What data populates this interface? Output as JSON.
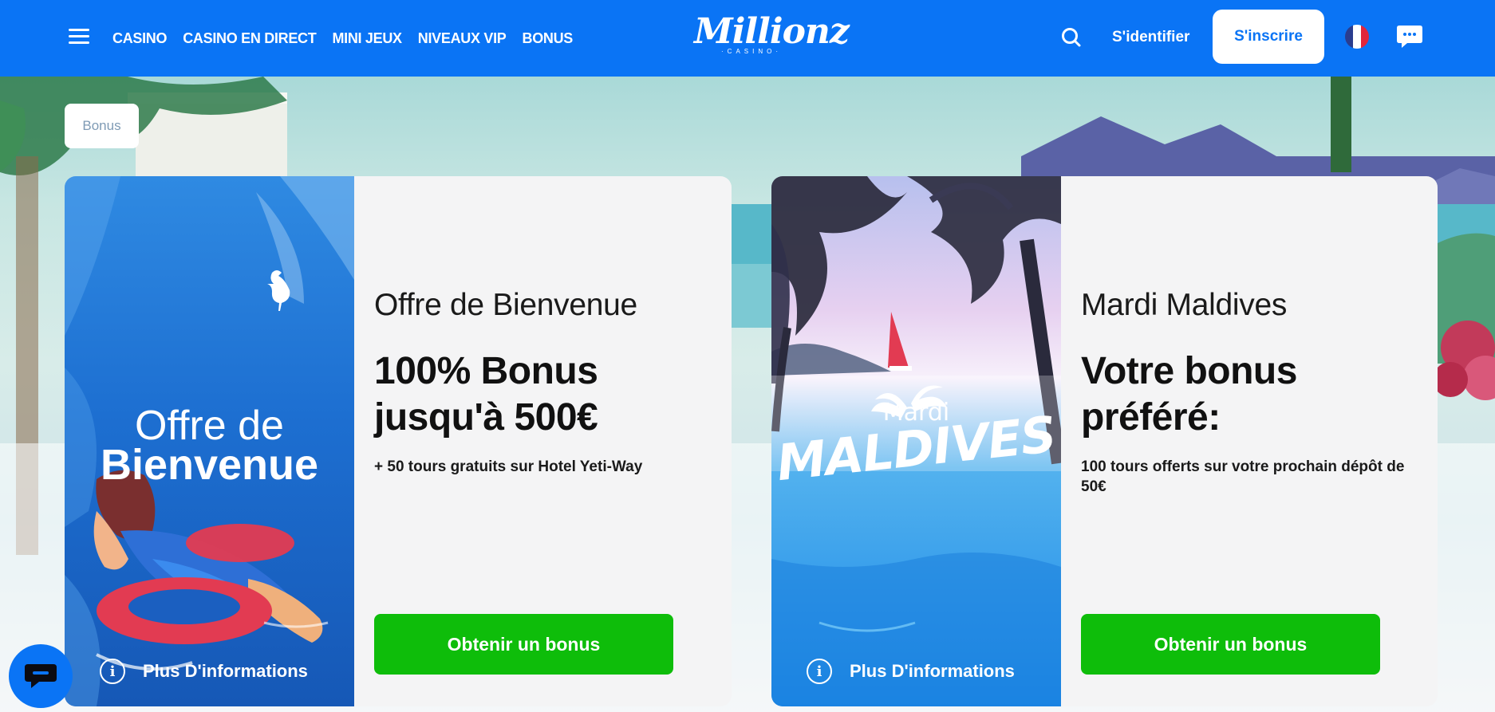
{
  "header": {
    "menu_icon": "hamburger-icon",
    "nav": [
      "CASINO",
      "CASINO EN DIRECT",
      "MINI JEUX",
      "NIVEAUX VIP",
      "BONUS"
    ],
    "logo_text": "Millionz",
    "logo_sub": "·CASINO·",
    "search_icon": "search-icon",
    "login_label": "S'identifier",
    "signup_label": "S'inscrire",
    "language_flag": "flag-icon",
    "chat_icon": "chat-bubble-icon",
    "brand_color": "#0a74f5"
  },
  "breadcrumb": "Bonus",
  "cards": [
    {
      "image_line1": "Offre de",
      "image_line2": "Bienvenue",
      "title": "Offre de Bienvenue",
      "headline": "100% Bonus jusqu'à 500€",
      "description": "+ 50 tours gratuits sur Hotel Yeti-Way",
      "button_label": "Obtenir un bonus",
      "more_info_label": "Plus D'informations"
    },
    {
      "image_line1": "Mardi",
      "image_line2": "MALDIVES",
      "title": "Mardi Maldives",
      "headline": "Votre bonus préféré:",
      "description": "100 tours offerts sur votre prochain dépôt de 50€",
      "button_label": "Obtenir un bonus",
      "more_info_label": "Plus D'informations"
    }
  ],
  "colors": {
    "button_green": "#0ebd0a",
    "card_bg": "#f4f4f5"
  },
  "floating_chat_icon": "chat-icon"
}
